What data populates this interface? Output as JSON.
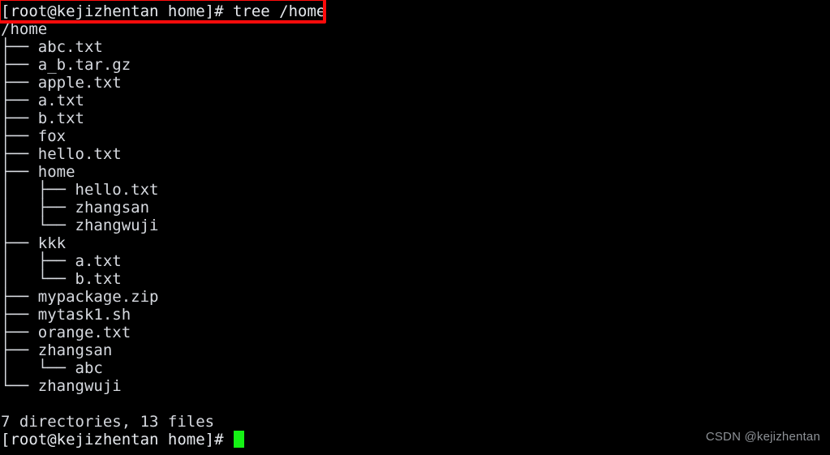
{
  "terminal": {
    "background_color": "#000000",
    "foreground_color": "#d4d7dd",
    "cursor_color": "#15f215",
    "highlight_color": "#fe0b0b",
    "command_line": "[root@kejizhentan home]# tree /home",
    "root_line": "/home",
    "tree_lines": [
      "├── abc.txt",
      "├── a_b.tar.gz",
      "├── apple.txt",
      "├── a.txt",
      "├── b.txt",
      "├── fox",
      "├── hello.txt",
      "├── home",
      "│   ├── hello.txt",
      "│   ├── zhangsan",
      "│   └── zhangwuji",
      "├── kkk",
      "│   ├── a.txt",
      "│   └── b.txt",
      "├── mypackage.zip",
      "├── mytask1.sh",
      "├── orange.txt",
      "├── zhangsan",
      "│   └── abc",
      "└── zhangwuji"
    ],
    "blank_line": "",
    "summary_line": "7 directories, 13 files",
    "prompt_line": "[root@kejizhentan home]# ",
    "cursor_glyph": "block-cursor"
  },
  "watermark": {
    "text": "CSDN @kejizhentan"
  }
}
